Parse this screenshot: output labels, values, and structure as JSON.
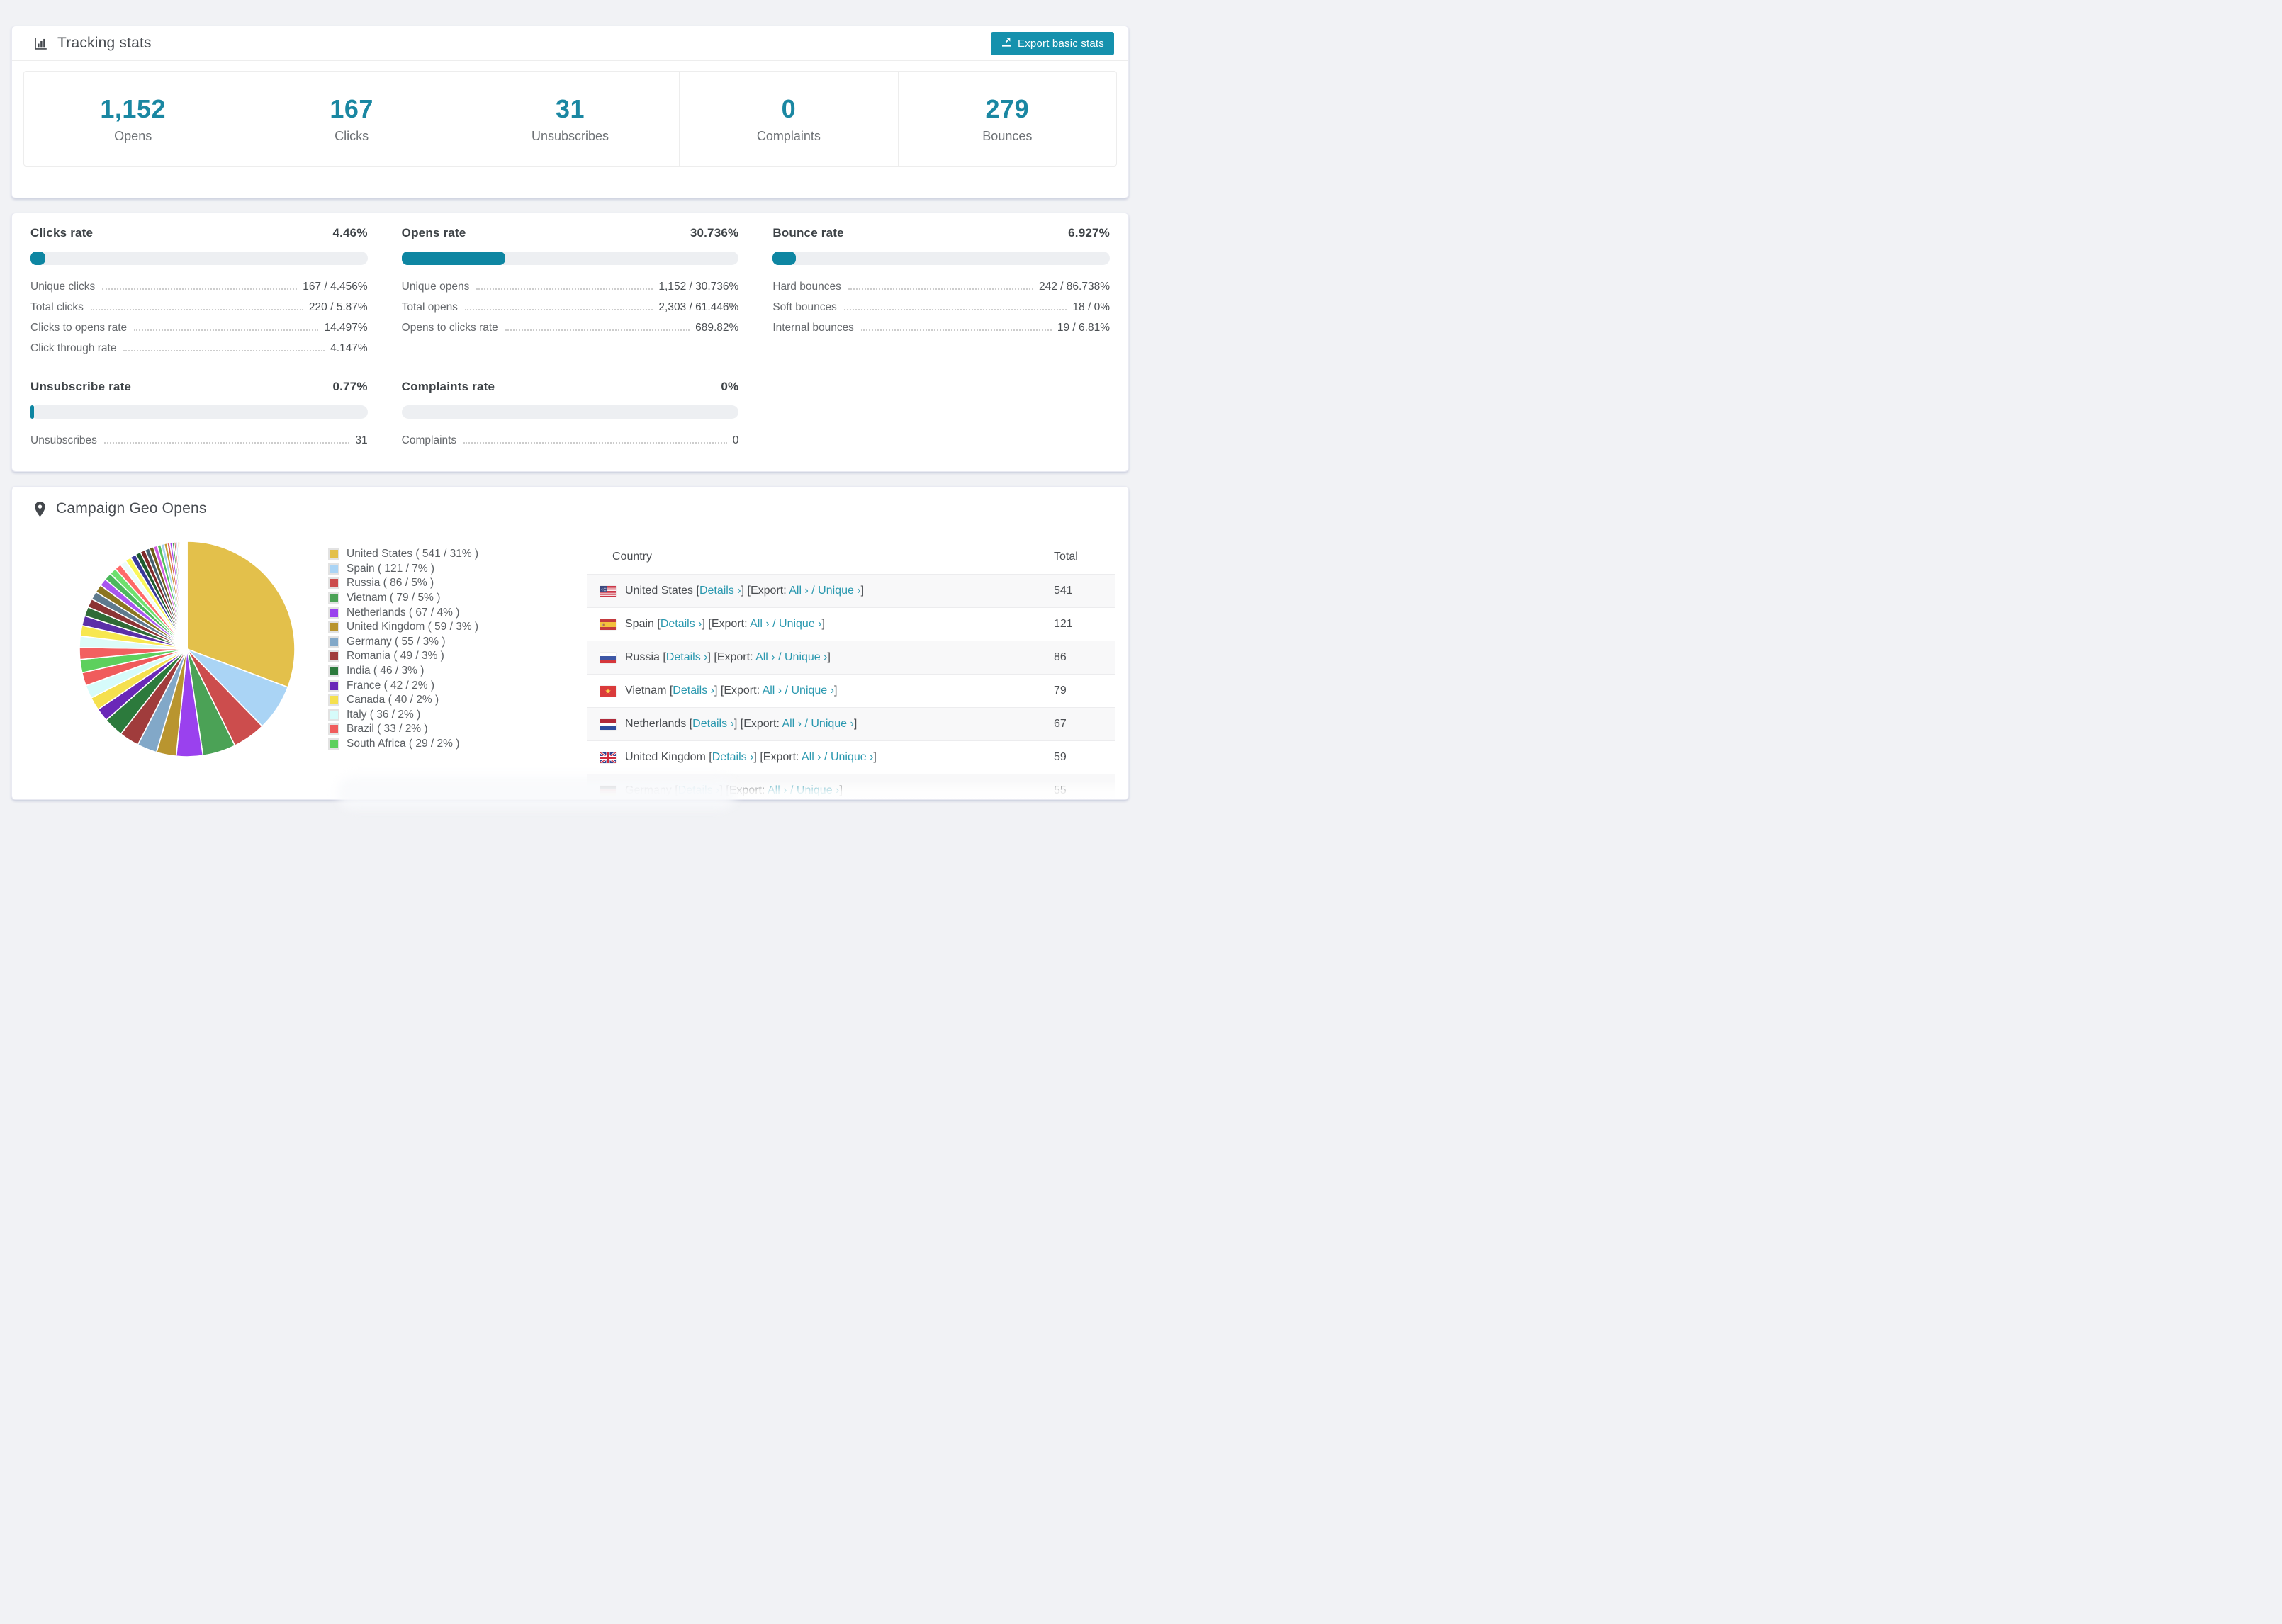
{
  "colors": {
    "accent_teal": "#1a87a2",
    "button_teal": "#1591ad",
    "link_teal": "#2a98af",
    "bar_fill_teal": "#0e86a2",
    "bar_track_gray": "#edeff2",
    "page_background": "#f1f2f5"
  },
  "tracking": {
    "title": "Tracking stats",
    "export_button_label": "Export basic stats",
    "stats": [
      {
        "value": "1,152",
        "label": "Opens"
      },
      {
        "value": "167",
        "label": "Clicks"
      },
      {
        "value": "31",
        "label": "Unsubscribes"
      },
      {
        "value": "0",
        "label": "Complaints"
      },
      {
        "value": "279",
        "label": "Bounces"
      }
    ]
  },
  "rates": {
    "sections": [
      {
        "title": "Clicks rate",
        "rate": "4.46%",
        "bar_pct": 4.46,
        "rows": [
          {
            "label": "Unique clicks",
            "value": "167 / 4.456%"
          },
          {
            "label": "Total clicks",
            "value": "220 / 5.87%"
          },
          {
            "label": "Clicks to opens rate",
            "value": "14.497%"
          },
          {
            "label": "Click through rate",
            "value": "4.147%"
          }
        ]
      },
      {
        "title": "Opens rate",
        "rate": "30.736%",
        "bar_pct": 30.736,
        "rows": [
          {
            "label": "Unique opens",
            "value": "1,152 / 30.736%"
          },
          {
            "label": "Total opens",
            "value": "2,303 / 61.446%"
          },
          {
            "label": "Opens to clicks rate",
            "value": "689.82%"
          }
        ]
      },
      {
        "title": "Bounce rate",
        "rate": "6.927%",
        "bar_pct": 6.927,
        "rows": [
          {
            "label": "Hard bounces",
            "value": "242 / 86.738%"
          },
          {
            "label": "Soft bounces",
            "value": "18 / 0%"
          },
          {
            "label": "Internal bounces",
            "value": "19 / 6.81%"
          }
        ]
      },
      {
        "title": "Unsubscribe rate",
        "rate": "0.77%",
        "bar_pct": 0.77,
        "rows": [
          {
            "label": "Unsubscribes",
            "value": "31"
          }
        ]
      },
      {
        "title": "Complaints rate",
        "rate": "0%",
        "bar_pct": 0,
        "rows": [
          {
            "label": "Complaints",
            "value": "0"
          }
        ]
      }
    ]
  },
  "geo": {
    "title": "Campaign Geo Opens",
    "table": {
      "country_header": "Country",
      "total_header": "Total",
      "details_label": "Details",
      "export_label": "Export:",
      "all_label": "All",
      "unique_label": "Unique",
      "chevron": "›",
      "rows": [
        {
          "country": "United States",
          "flag": "us",
          "total": "541"
        },
        {
          "country": "Spain",
          "flag": "es",
          "total": "121"
        },
        {
          "country": "Russia",
          "flag": "ru",
          "total": "86"
        },
        {
          "country": "Vietnam",
          "flag": "vn",
          "total": "79"
        },
        {
          "country": "Netherlands",
          "flag": "nl",
          "total": "67"
        },
        {
          "country": "United Kingdom",
          "flag": "gb",
          "total": "59"
        },
        {
          "country": "Germany",
          "flag": "de",
          "total": "55"
        }
      ]
    }
  },
  "chart_data": {
    "type": "pie",
    "title": "Campaign Geo Opens",
    "legend_position": "right-of-pie",
    "start_angle_deg": 0,
    "direction": "clockwise",
    "series": [
      {
        "name": "United States",
        "count": 541,
        "pct": 31,
        "color": "#e3c04b"
      },
      {
        "name": "Spain",
        "count": 121,
        "pct": 7,
        "color": "#aad4f5"
      },
      {
        "name": "Russia",
        "count": 86,
        "pct": 5,
        "color": "#cc4d4d"
      },
      {
        "name": "Vietnam",
        "count": 79,
        "pct": 5,
        "color": "#4ba256"
      },
      {
        "name": "Netherlands",
        "count": 67,
        "pct": 4,
        "color": "#9a41ee"
      },
      {
        "name": "United Kingdom",
        "count": 59,
        "pct": 3,
        "color": "#b9952f"
      },
      {
        "name": "Germany",
        "count": 55,
        "pct": 3,
        "color": "#82a8c8"
      },
      {
        "name": "Romania",
        "count": 49,
        "pct": 3,
        "color": "#a03c3c"
      },
      {
        "name": "India",
        "count": 46,
        "pct": 3,
        "color": "#2c7a3c"
      },
      {
        "name": "France",
        "count": 42,
        "pct": 2,
        "color": "#6a28b8"
      },
      {
        "name": "Canada",
        "count": 40,
        "pct": 2,
        "color": "#f5e04e"
      },
      {
        "name": "Italy",
        "count": 36,
        "pct": 2,
        "color": "#d6fbfa"
      },
      {
        "name": "Brazil",
        "count": 33,
        "pct": 2,
        "color": "#f05c5c"
      },
      {
        "name": "South Africa",
        "count": 29,
        "pct": 2,
        "color": "#5dd05d"
      }
    ],
    "unlabeled_small_slices": {
      "note": "long tail of countries under 2 percent, shown as thin unlabeled slices",
      "values": [
        1.8,
        1.7,
        1.6,
        1.5,
        1.4,
        1.3,
        1.25,
        1.2,
        1.15,
        1.1,
        1.05,
        1.0,
        0.95,
        0.9,
        0.85,
        0.8,
        0.75,
        0.7,
        0.65,
        0.6,
        0.55,
        0.5,
        0.45,
        0.4,
        0.35,
        0.3,
        0.27,
        0.24,
        0.21,
        0.18,
        0.16,
        0.14,
        0.12,
        0.1,
        0.09,
        0.08,
        0.07,
        0.06,
        0.05,
        0.04,
        0.04,
        0.03,
        0.03,
        0.02,
        0.02
      ],
      "colors": [
        "#f26060",
        "#dcfbf8",
        "#f7e74f",
        "#5b2fa8",
        "#2f6b36",
        "#8c3434",
        "#5e7a8e",
        "#8c7520",
        "#a855f0",
        "#4cb85c",
        "#6ee06e",
        "#ff6a6a",
        "#ecfcfb",
        "#faf75a",
        "#39399a",
        "#1e5c2e",
        "#7e2929",
        "#46606e",
        "#6e5d18",
        "#cf5ae0",
        "#50c05a",
        "#a5d0f0",
        "#c29a32",
        "#e05858",
        "#9a41ee",
        "#4ba256",
        "#cc4d4d",
        "#aad4f5",
        "#e3c04b",
        "#b9952f",
        "#82a8c8",
        "#a03c3c",
        "#2c7a3c",
        "#6a28b8",
        "#f5e04e",
        "#d6fbfa",
        "#f05c5c",
        "#5dd05d",
        "#e560e5",
        "#7a3fd5",
        "#58c863",
        "#b565f5",
        "#9ecdf2",
        "#c09a30",
        "#e05555"
      ]
    }
  }
}
